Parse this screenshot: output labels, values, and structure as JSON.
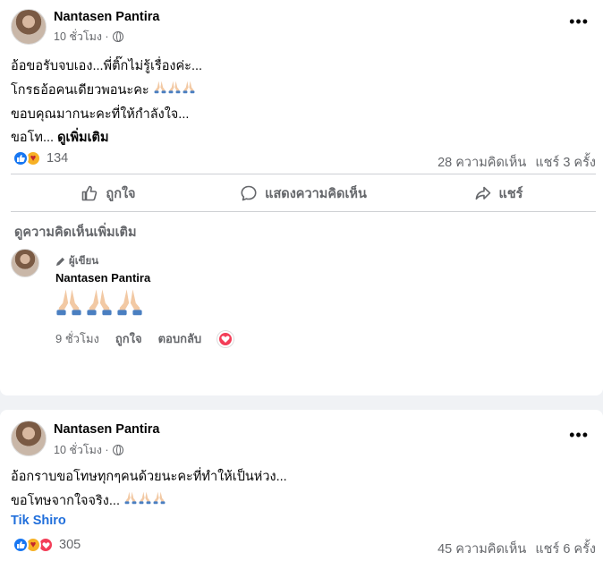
{
  "post1": {
    "author": "Nantasen Pantira",
    "time": "10 ชั่วโมง ·",
    "lines": [
      "อ้อขอรับจบเอง...พี่ติ๊กไม่รู้เรื่องค่ะ...",
      "โกรธอ้อคนเดียวพอนะคะ",
      "ขอบคุณมากนะคะที่ให้กำลังใจ...",
      "ขอโท..."
    ],
    "see_more": "ดูเพิ่มเติม",
    "reaction_count": "134",
    "comments": "28 ความคิดเห็น",
    "shares": "แชร์ 3 ครั้ง",
    "actions": {
      "like": "ถูกใจ",
      "comment": "แสดงความคิดเห็น",
      "share": "แชร์"
    },
    "view_more_comments": "ดูความคิดเห็นเพิ่มเติม",
    "comment": {
      "badge": "ผู้เขียน",
      "author": "Nantasen Pantira",
      "time": "9 ชั่วโมง",
      "like": "ถูกใจ",
      "reply": "ตอบกลับ"
    }
  },
  "post2": {
    "author": "Nantasen Pantira",
    "time": "10 ชั่วโมง ·",
    "lines": [
      "อ้อกราบขอโทษทุกๆคนด้วยนะคะที่ทำให้เป็นห่วง...",
      "ขอโทษจากใจจริง..."
    ],
    "tag": "Tik Shiro",
    "reaction_count": "305",
    "comments": "45 ความคิดเห็น",
    "shares": "แชร์ 6 ครั้ง"
  },
  "colors": {
    "like": "#1877f2",
    "love": "#f33e58",
    "care": "#f7b125",
    "link": "#216fdb",
    "muted": "#65676b"
  }
}
